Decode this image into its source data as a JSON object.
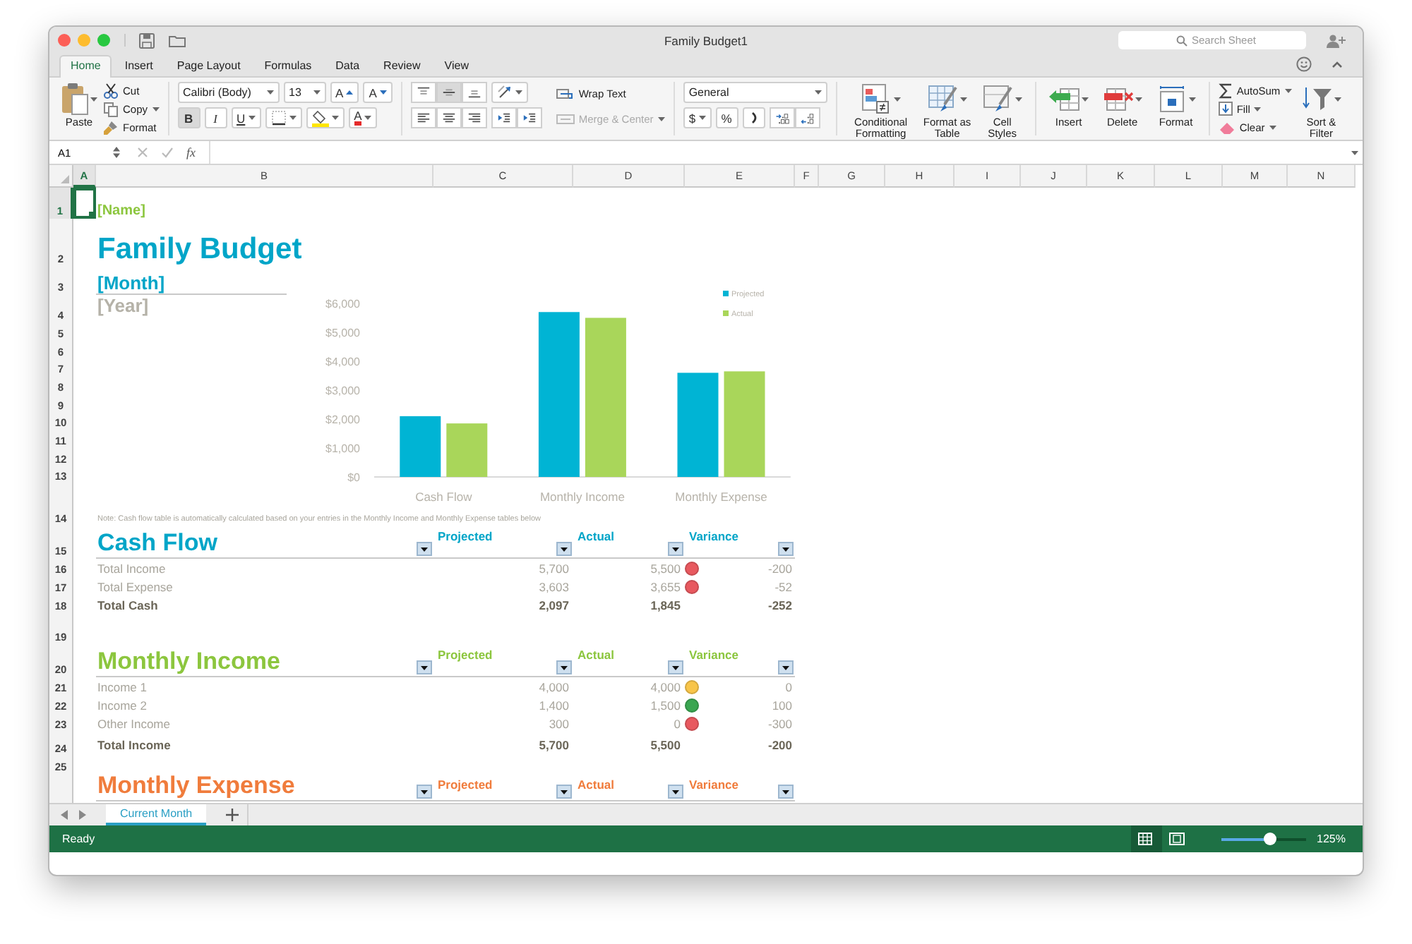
{
  "window": {
    "title": "Family Budget1",
    "search_placeholder": "Search Sheet"
  },
  "ribbon_tabs": [
    {
      "label": "Home",
      "selected": true
    },
    {
      "label": "Insert",
      "selected": false
    },
    {
      "label": "Page Layout",
      "selected": false
    },
    {
      "label": "Formulas",
      "selected": false
    },
    {
      "label": "Data",
      "selected": false
    },
    {
      "label": "Review",
      "selected": false
    },
    {
      "label": "View",
      "selected": false
    }
  ],
  "ribbon": {
    "clipboard": {
      "paste": "Paste",
      "cut": "Cut",
      "copy": "Copy",
      "format": "Format"
    },
    "font": {
      "name": "Calibri (Body)",
      "size": "13",
      "grow": "A",
      "shrink": "A",
      "bold": {
        "label": "B",
        "pressed": true
      },
      "italic": {
        "label": "I",
        "pressed": false
      },
      "underline": {
        "label": "U",
        "pressed": false
      },
      "font_color": "A"
    },
    "alignment": {
      "vertical": [
        {
          "kind": "top",
          "selected": false
        },
        {
          "kind": "middle",
          "selected": true
        },
        {
          "kind": "bottom",
          "selected": false
        }
      ],
      "horizontal": [
        {
          "kind": "left",
          "selected": false
        },
        {
          "kind": "center",
          "selected": false
        },
        {
          "kind": "right",
          "selected": false
        }
      ],
      "wrap_text": "Wrap Text",
      "merge": {
        "label": "Merge & Center",
        "disabled": true
      }
    },
    "number": {
      "format": "General",
      "currency": "$",
      "percent": "%"
    },
    "styles": [
      "Conditional Formatting",
      "Format as Table",
      "Cell Styles"
    ],
    "cells": [
      "Insert",
      "Delete",
      "Format"
    ],
    "editing": {
      "autosum": "AutoSum",
      "fill": "Fill",
      "clear": "Clear",
      "sort_filter": "Sort & Filter"
    }
  },
  "formula_bar": {
    "name_box": "A1",
    "function_label": "fx"
  },
  "sheet": {
    "columns": [
      {
        "label": "A",
        "selected": true
      },
      {
        "label": "B",
        "selected": false
      },
      {
        "label": "C",
        "selected": false
      },
      {
        "label": "D",
        "selected": false
      },
      {
        "label": "E",
        "selected": false
      },
      {
        "label": "F",
        "selected": false
      },
      {
        "label": "G",
        "selected": false
      },
      {
        "label": "H",
        "selected": false
      },
      {
        "label": "I",
        "selected": false
      },
      {
        "label": "J",
        "selected": false
      },
      {
        "label": "K",
        "selected": false
      },
      {
        "label": "L",
        "selected": false
      },
      {
        "label": "M",
        "selected": false
      },
      {
        "label": "N",
        "selected": false
      }
    ],
    "rows": [
      {
        "label": "1",
        "selected": true
      },
      {
        "label": "2",
        "selected": false
      },
      {
        "label": "3",
        "selected": false
      },
      {
        "label": "4",
        "selected": false
      },
      {
        "label": "5",
        "selected": false
      },
      {
        "label": "6",
        "selected": false
      },
      {
        "label": "7",
        "selected": false
      },
      {
        "label": "8",
        "selected": false
      },
      {
        "label": "9",
        "selected": false
      },
      {
        "label": "10",
        "selected": false
      },
      {
        "label": "11",
        "selected": false
      },
      {
        "label": "12",
        "selected": false
      },
      {
        "label": "13",
        "selected": false
      },
      {
        "label": "14",
        "selected": false
      },
      {
        "label": "15",
        "selected": false
      },
      {
        "label": "16",
        "selected": false
      },
      {
        "label": "17",
        "selected": false
      },
      {
        "label": "18",
        "selected": false
      },
      {
        "label": "19",
        "selected": false
      },
      {
        "label": "20",
        "selected": false
      },
      {
        "label": "21",
        "selected": false
      },
      {
        "label": "22",
        "selected": false
      },
      {
        "label": "23",
        "selected": false
      },
      {
        "label": "24",
        "selected": false
      },
      {
        "label": "25",
        "selected": false
      }
    ]
  },
  "sheet_header": {
    "name": "[Name]",
    "title": "Family Budget",
    "month": "[Month]",
    "year": "[Year]"
  },
  "chart": {
    "chart_data": {
      "type": "bar",
      "categories": [
        "Cash Flow",
        "Monthly Income",
        "Monthly Expense"
      ],
      "series": [
        {
          "name": "Projected",
          "color": "#00b4d4",
          "values": [
            2100,
            5700,
            3600
          ]
        },
        {
          "name": "Actual",
          "color": "#a9d65a",
          "values": [
            1850,
            5500,
            3650
          ]
        }
      ],
      "legend": "right",
      "ylim": [
        0,
        6000
      ],
      "yticks": [
        {
          "value": 0,
          "label": "$0"
        },
        {
          "value": 1000,
          "label": "$1,000"
        },
        {
          "value": 2000,
          "label": "$2,000"
        },
        {
          "value": 3000,
          "label": "$3,000"
        },
        {
          "value": 4000,
          "label": "$4,000"
        },
        {
          "value": 5000,
          "label": "$5,000"
        },
        {
          "value": 6000,
          "label": "$6,000"
        }
      ]
    }
  },
  "note": "Note: Cash flow table is automatically calculated based on your entries in the Monthly Income and Monthly Expense tables below",
  "tables": [
    {
      "title": "Cash Flow",
      "color": "#00a5c8",
      "columns": [
        "Projected",
        "Actual",
        "Variance"
      ],
      "rows": [
        {
          "kind": "item",
          "label": "Total Income",
          "projected": "5,700",
          "actual": "5,500",
          "variance": "-200",
          "color": "#e8595f"
        },
        {
          "kind": "item",
          "label": "Total Expense",
          "projected": "3,603",
          "actual": "3,655",
          "variance": "-52",
          "color": "#e8595f"
        },
        {
          "kind": "total",
          "label": "Total Cash",
          "projected": "2,097",
          "actual": "1,845",
          "variance": "-252"
        }
      ]
    },
    {
      "title": "Monthly Income",
      "color": "#8cc63e",
      "columns": [
        "Projected",
        "Actual",
        "Variance"
      ],
      "rows": [
        {
          "kind": "item",
          "label": "Income 1",
          "projected": "4,000",
          "actual": "4,000",
          "variance": "0",
          "color": "#f8c54a"
        },
        {
          "kind": "item",
          "label": "Income 2",
          "projected": "1,400",
          "actual": "1,500",
          "variance": "100",
          "color": "#3aa651"
        },
        {
          "kind": "item",
          "label": "Other Income",
          "projected": "300",
          "actual": "0",
          "variance": "-300",
          "color": "#e8595f"
        },
        {
          "kind": "total",
          "label": "Total Income",
          "projected": "5,700",
          "actual": "5,500",
          "variance": "-200"
        }
      ]
    },
    {
      "title": "Monthly Expense",
      "color": "#f07c3c",
      "columns": [
        "Projected",
        "Actual",
        "Variance"
      ]
    }
  ],
  "sheet_tabs": [
    {
      "label": "Current Month",
      "selected": true
    }
  ],
  "status_bar": {
    "status": "Ready",
    "views": [
      {
        "kind": "normal",
        "selected": true
      },
      {
        "kind": "page_layout",
        "selected": false
      }
    ],
    "zoom": {
      "level": 0.58,
      "reading": "125%"
    }
  }
}
